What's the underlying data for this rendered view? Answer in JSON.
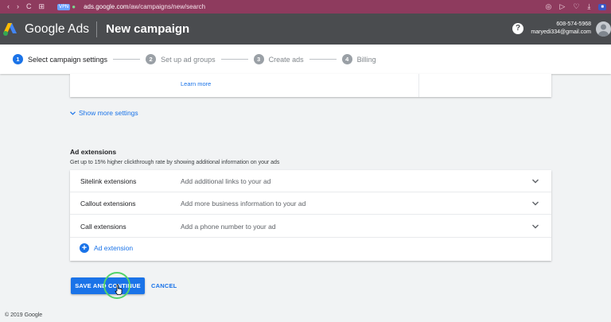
{
  "browser": {
    "nav_back": "‹",
    "nav_forward": "›",
    "reload": "C",
    "grid": "⊞",
    "vpn_badge": "VPN",
    "url_domain": "ads.google.com",
    "url_path": "/aw/campaigns/new/search"
  },
  "header": {
    "brand": "Google Ads",
    "title": "New campaign",
    "help": "?",
    "phone": "608-574-5968",
    "email": "maryedi334@gmail.com"
  },
  "steps": [
    {
      "num": "1",
      "label": "Select campaign settings",
      "active": true
    },
    {
      "num": "2",
      "label": "Set up ad groups",
      "active": false
    },
    {
      "num": "3",
      "label": "Create ads",
      "active": false
    },
    {
      "num": "4",
      "label": "Billing",
      "active": false
    }
  ],
  "top_card": {
    "learn_more": "Learn more"
  },
  "more_settings": "Show more settings",
  "ad_extensions": {
    "title": "Ad extensions",
    "description": "Get up to 15% higher clickthrough rate by showing additional information on your ads",
    "rows": [
      {
        "name": "Sitelink extensions",
        "desc": "Add additional links to your ad"
      },
      {
        "name": "Callout extensions",
        "desc": "Add more business information to your ad"
      },
      {
        "name": "Call extensions",
        "desc": "Add a phone number to your ad"
      }
    ],
    "add_label": "Ad extension"
  },
  "actions": {
    "save": "SAVE AND CONTINUE",
    "cancel": "CANCEL"
  },
  "footer": "© 2019 Google",
  "colors": {
    "accent": "#1a73e8",
    "header_bg": "#4a4c4f",
    "browser_bar": "#8e3b5e",
    "click_ring": "#53d36a"
  }
}
